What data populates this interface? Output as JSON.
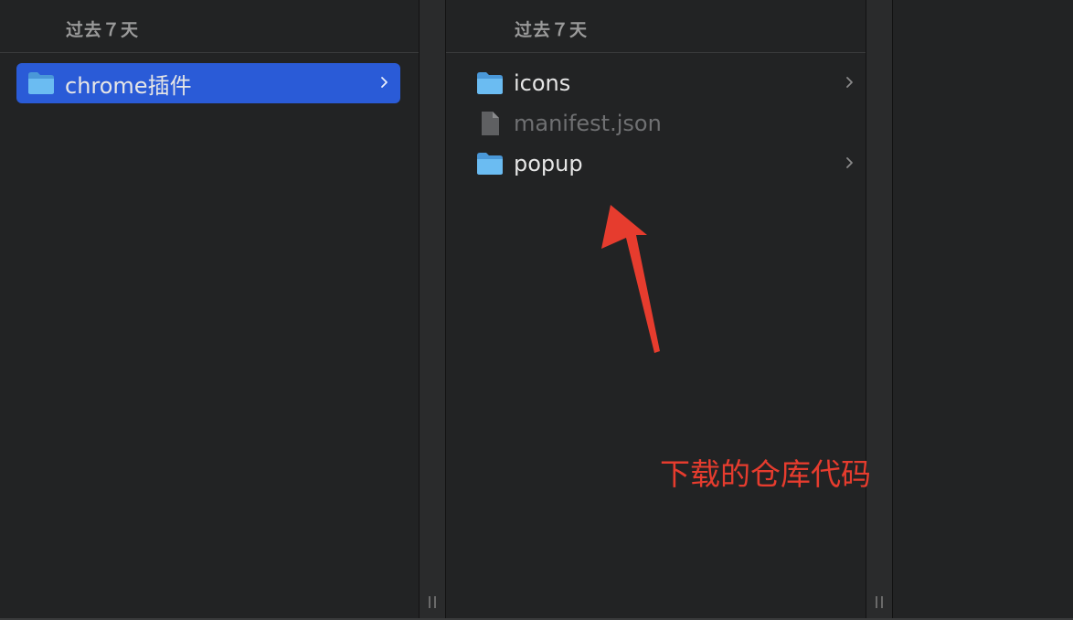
{
  "columns": [
    {
      "header": "过去７天",
      "items": [
        {
          "label": "chrome插件",
          "icon": "folder-icon",
          "selected": true,
          "has_children": true
        }
      ]
    },
    {
      "header": "过去７天",
      "items": [
        {
          "label": "icons",
          "icon": "folder-icon",
          "has_children": true
        },
        {
          "label": "manifest.json",
          "icon": "document-icon",
          "dimmed": true,
          "has_children": false
        },
        {
          "label": "popup",
          "icon": "folder-icon",
          "has_children": true
        }
      ]
    }
  ],
  "annotation": {
    "text": "下载的仓库代码",
    "color": "#e63c2e"
  },
  "colors": {
    "selection": "#2a5bd7",
    "folder": "#5ab0ec",
    "background": "#222324"
  }
}
